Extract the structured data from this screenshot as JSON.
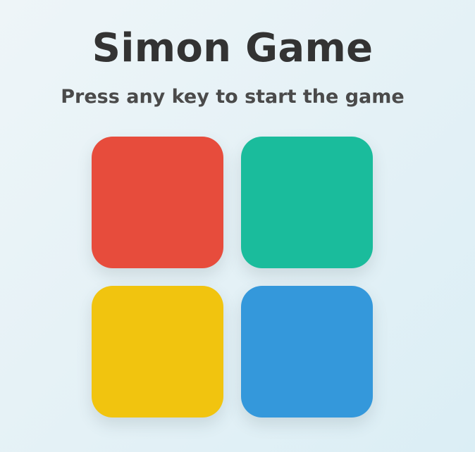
{
  "game": {
    "title": "Simon Game",
    "status": "Press any key to start the game"
  },
  "pads": [
    {
      "id": "red",
      "color": "#e74c3c"
    },
    {
      "id": "green",
      "color": "#1abc9c"
    },
    {
      "id": "yellow",
      "color": "#f1c40f"
    },
    {
      "id": "blue",
      "color": "#3498db"
    }
  ]
}
